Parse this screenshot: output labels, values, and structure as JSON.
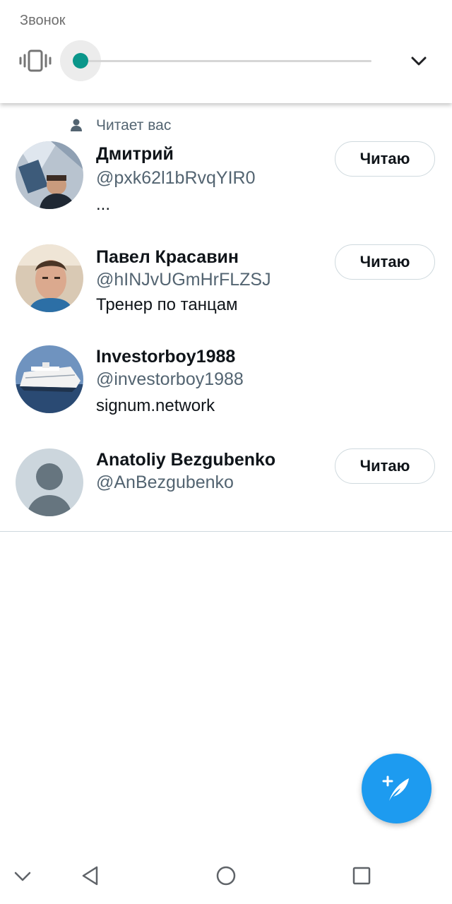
{
  "volume_panel": {
    "label": "Звонок",
    "level": 0,
    "accent_color": "#0a968a",
    "icons": [
      "vibrate-icon",
      "chevron-down-icon"
    ]
  },
  "followers": {
    "follows_you_label": "Читает вас",
    "users": [
      {
        "name": "Дмитрий",
        "handle": "@pxk62l1bRvqYIR0",
        "bio": "...",
        "button_label": "Читаю"
      },
      {
        "name": "Павел Красавин",
        "handle": "@hINJvUGmHrFLZSJ",
        "bio": "Тренер по танцам",
        "button_label": "Читаю"
      },
      {
        "name": "Investorboy1988",
        "handle": "@investorboy1988",
        "bio": "signum.network"
      },
      {
        "name": "Anatoliy Bezgubenko",
        "handle": "@AnBezgubenko",
        "button_label": "Читаю"
      }
    ]
  },
  "fab": {
    "icon": "compose-tweet-icon",
    "color": "#1d9bf0"
  },
  "nav_bar": {
    "icons": [
      "chevron-down-icon",
      "back-icon",
      "home-icon",
      "recents-icon"
    ]
  }
}
